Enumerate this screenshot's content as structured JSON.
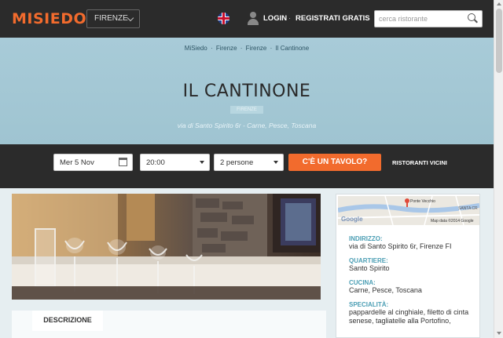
{
  "header": {
    "logo": "MISIEDO",
    "city": "FIRENZE",
    "login": "LOGIN",
    "separator": "·",
    "register": "REGISTRATI GRATIS",
    "search_placeholder": "cerca ristorante"
  },
  "breadcrumb": [
    "MiSiedo",
    "Firenze",
    "Firenze",
    "Il Cantinone"
  ],
  "breadcrumb_sep": "·",
  "restaurant": {
    "name": "IL CANTINONE",
    "city_badge": "FIRENZE",
    "subtitle": "via di Santo Spirito 6r - Carne, Pesce, Toscana"
  },
  "booking": {
    "date": "Mer 5 Nov",
    "time": "20:00",
    "people": "2 persone",
    "cta": "C'È UN TAVOLO?",
    "nearby": "RISTORANTI VICINI"
  },
  "map": {
    "place_label": "Ponte Vecchio",
    "area_label": "SANTA CR",
    "attribution": "Map data ©2014 Google",
    "brand": "Google"
  },
  "info": [
    {
      "label": "INDIRIZZO:",
      "value": "via di Santo Spirito 6r, Firenze FI"
    },
    {
      "label": "QUARTIERE:",
      "value": "Santo Spirito"
    },
    {
      "label": "CUCINA:",
      "value": "Carne, Pesce, Toscana"
    },
    {
      "label": "SPECIALITÀ:",
      "value": "pappardelle al cinghiale, filetto di cinta senese, tagliatelle alla Portofino,"
    }
  ],
  "tabs": {
    "description": "DESCRIZIONE"
  },
  "colors": {
    "accent": "#f26b2d",
    "label": "#4b9eb4",
    "dark": "#2b2b2b",
    "hero": "#a8cbd8"
  }
}
